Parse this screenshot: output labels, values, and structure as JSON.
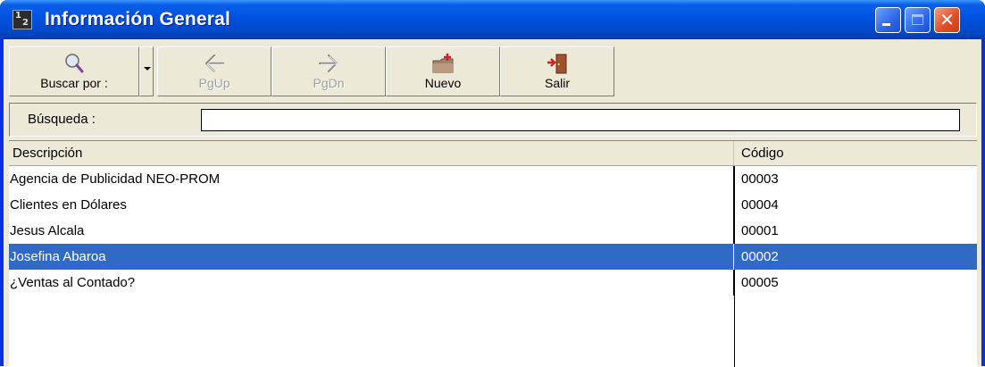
{
  "window": {
    "title": "Información General",
    "colors": {
      "titlebar": "#0054e3",
      "selection": "#316ac5"
    }
  },
  "toolbar": {
    "buscar_label": "Buscar por :",
    "pgup_label": "PgUp",
    "pgdn_label": "PgDn",
    "nuevo_label": "Nuevo",
    "salir_label": "Salir",
    "icons": [
      "magnifier-icon",
      "arrow-left-icon",
      "arrow-right-icon",
      "new-folder-icon",
      "exit-door-icon"
    ]
  },
  "search": {
    "label": "Búsqueda :",
    "value": ""
  },
  "grid": {
    "columns": [
      "Descripción",
      "Código"
    ],
    "rows": [
      {
        "descripcion": "Agencia de Publicidad NEO-PROM",
        "codigo": "00003"
      },
      {
        "descripcion": "Clientes en Dólares",
        "codigo": "00004"
      },
      {
        "descripcion": "Jesus Alcala",
        "codigo": "00001"
      },
      {
        "descripcion": "Josefina Abaroa",
        "codigo": "00002"
      },
      {
        "descripcion": "¿Ventas al Contado?",
        "codigo": "00005"
      }
    ],
    "selected_index": 3
  }
}
